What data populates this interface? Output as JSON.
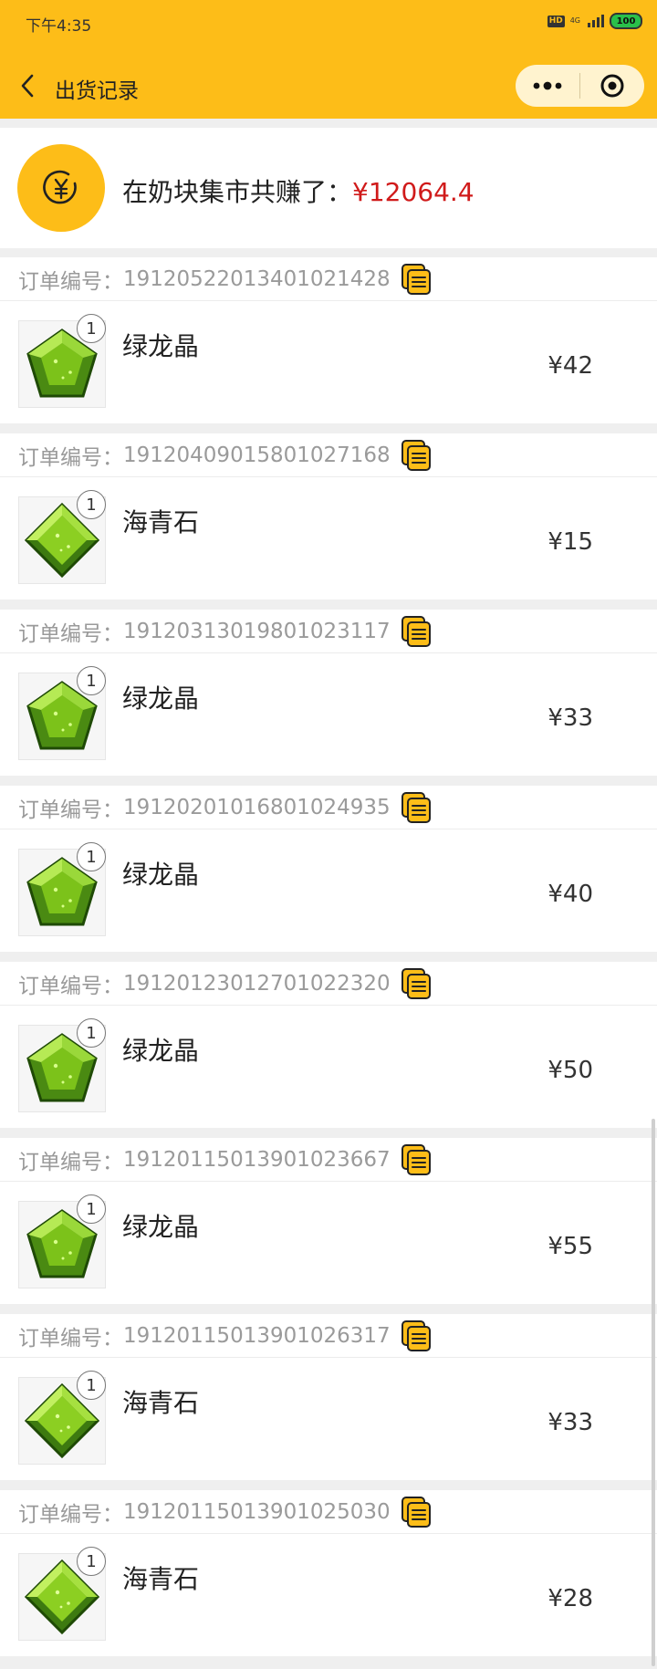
{
  "status_bar": {
    "time": "下午4:35",
    "hd": "HD",
    "network_top": "4G",
    "network_bottom": "all",
    "battery": "100"
  },
  "nav": {
    "title": "出货记录",
    "back_icon": "chevron-left-icon",
    "more_icon": "more-dots-icon",
    "close_icon": "target-circle-icon"
  },
  "summary": {
    "label": "在奶块集市共赚了：",
    "amount": "¥12064.4",
    "icon": "yuan-coin-icon",
    "amount_color": "#d01a1a"
  },
  "orders": [
    {
      "label": "订单编号：",
      "id": "19120522013401021428",
      "quantity": "1",
      "name": "绿龙晶",
      "price": "¥42"
    },
    {
      "label": "订单编号：",
      "id": "19120409015801027168",
      "quantity": "1",
      "name": "海青石",
      "price": "¥15"
    },
    {
      "label": "订单编号：",
      "id": "19120313019801023117",
      "quantity": "1",
      "name": "绿龙晶",
      "price": "¥33"
    },
    {
      "label": "订单编号：",
      "id": "19120201016801024935",
      "quantity": "1",
      "name": "绿龙晶",
      "price": "¥40"
    },
    {
      "label": "订单编号：",
      "id": "19120123012701022320",
      "quantity": "1",
      "name": "绿龙晶",
      "price": "¥50"
    },
    {
      "label": "订单编号：",
      "id": "19120115013901023667",
      "quantity": "1",
      "name": "绿龙晶",
      "price": "¥55"
    },
    {
      "label": "订单编号：",
      "id": "19120115013901026317",
      "quantity": "1",
      "name": "海青石",
      "price": "¥33"
    },
    {
      "label": "订单编号：",
      "id": "19120115013901025030",
      "quantity": "1",
      "name": "海青石",
      "price": "¥28"
    }
  ],
  "colors": {
    "accent": "#fdbd18",
    "price_red": "#d01a1a",
    "gem_green": "#7cc21a"
  }
}
